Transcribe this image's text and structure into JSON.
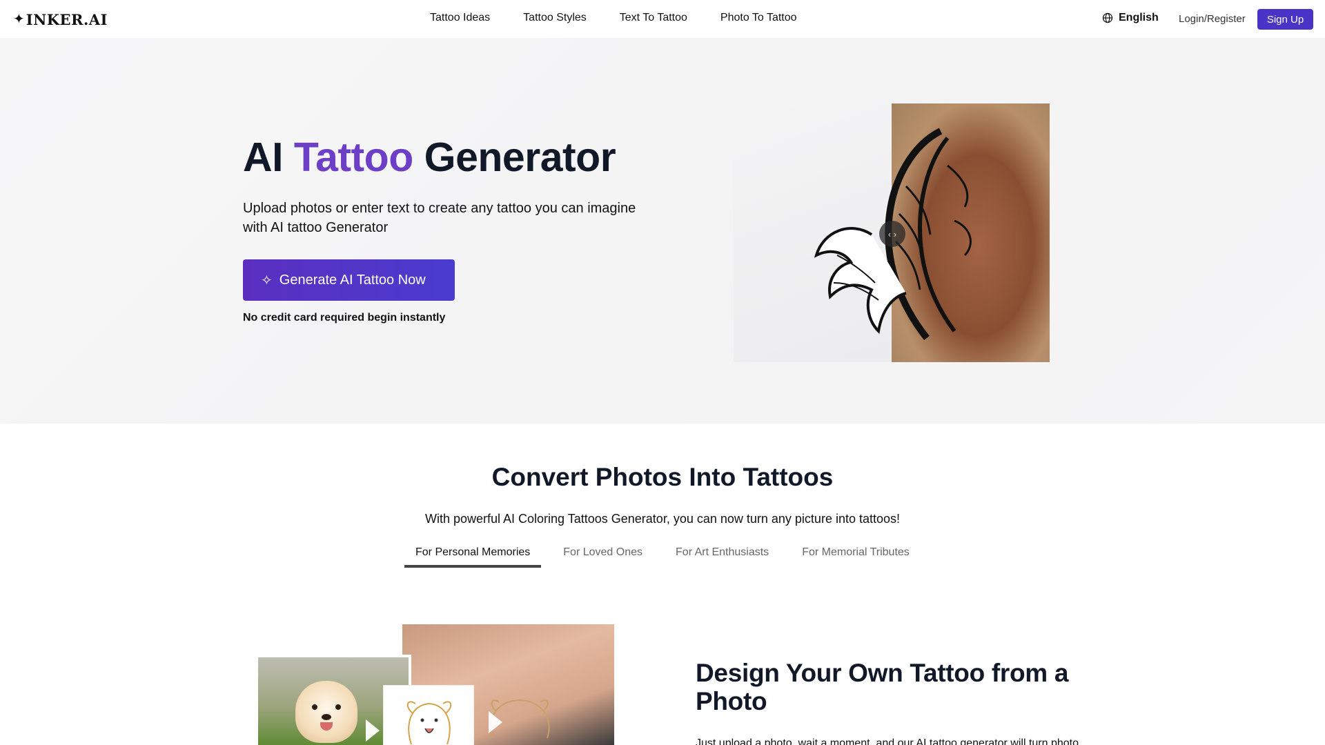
{
  "header": {
    "logo": "INKER.AI",
    "nav": [
      "Tattoo Ideas",
      "Tattoo Styles",
      "Text To Tattoo",
      "Photo To Tattoo"
    ],
    "language": "English",
    "login": "Login/Register",
    "signup": "Sign Up"
  },
  "hero": {
    "title_part1": "AI",
    "title_accent": "Tattoo",
    "title_part2": "Generator",
    "subtitle": "Upload photos or enter text to create any tattoo you can imagine with AI tattoo Generator",
    "cta": "Generate AI Tattoo Now",
    "note": "No credit card required begin instantly"
  },
  "convert": {
    "title": "Convert Photos Into Tattoos",
    "subtitle": "With powerful AI Coloring Tattoos Generator, you can now turn any picture into tattoos!",
    "tabs": [
      "For Personal Memories",
      "For Loved Ones",
      "For Art Enthusiasts",
      "For Memorial Tributes"
    ],
    "active_tab": 0
  },
  "design": {
    "title": "Design Your Own Tattoo from a Photo",
    "description": "Just upload a photo, wait a moment, and our AI tattoo generator will turn photo"
  },
  "colors": {
    "accent": "#6d3fc6",
    "button": "#4a34c8"
  }
}
